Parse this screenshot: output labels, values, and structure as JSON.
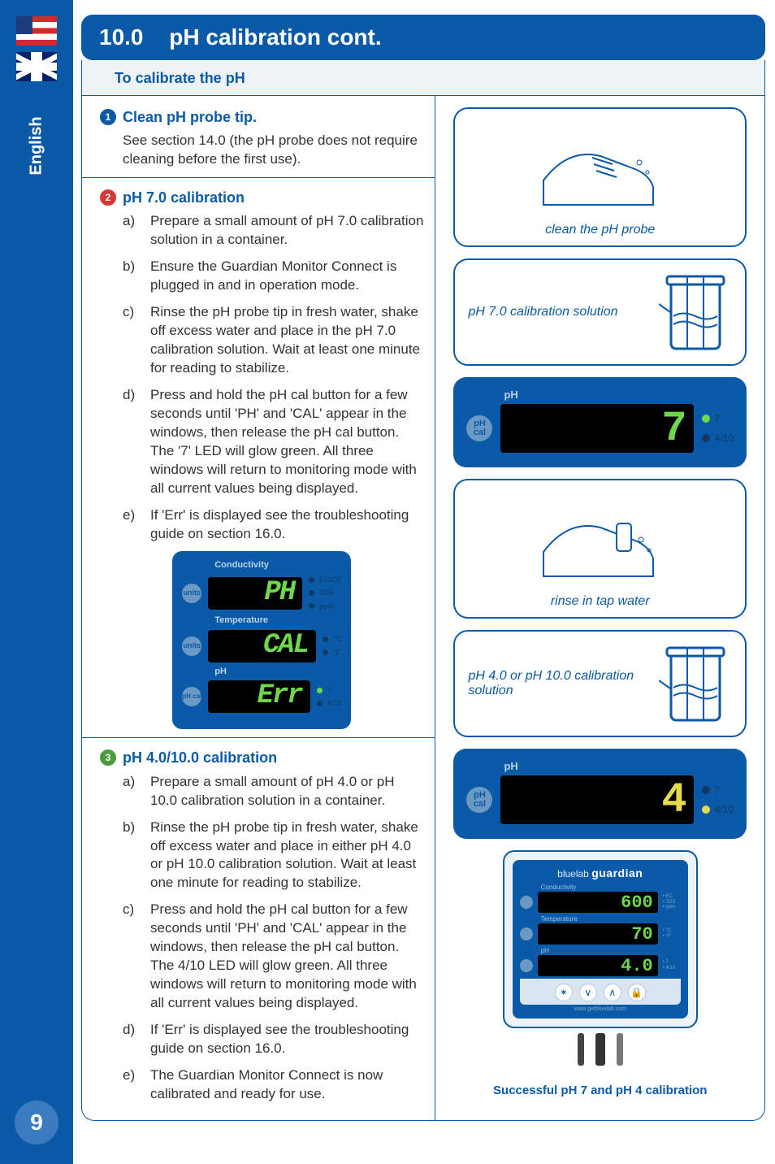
{
  "sidebar": {
    "language": "English",
    "page_number": "9"
  },
  "header": {
    "section_number": "10.0",
    "section_title": "pH calibration cont."
  },
  "subheader": "To calibrate the pH",
  "steps": {
    "s1": {
      "num": "1",
      "title": "Clean pH probe tip.",
      "body": "See section 14.0 (the pH probe does not require cleaning before the first use)."
    },
    "s2": {
      "num": "2",
      "title": "pH 7.0 calibration",
      "items": {
        "a": {
          "lbl": "a)",
          "txt": "Prepare a small amount of pH 7.0 calibration solution in a container."
        },
        "b": {
          "lbl": "b)",
          "txt": "Ensure the Guardian Monitor Connect is plugged in and in operation mode."
        },
        "c": {
          "lbl": "c)",
          "txt": "Rinse the pH probe tip in fresh water, shake off excess water and place in the pH 7.0 calibration solution. Wait at least one minute for reading to stabilize."
        },
        "d": {
          "lbl": "d)",
          "txt": "Press and hold the pH cal button for a few seconds until 'PH' and 'CAL' appear in the windows, then release the pH cal button. The '7' LED will glow green. All three windows will return to monitoring mode with all current values being displayed."
        },
        "e": {
          "lbl": "e)",
          "txt": "If 'Err' is displayed see the troubleshooting guide on section 16.0."
        }
      }
    },
    "s3": {
      "num": "3",
      "title": "pH 4.0/10.0 calibration",
      "items": {
        "a": {
          "lbl": "a)",
          "txt": "Prepare a small amount of pH 4.0 or pH 10.0 calibration solution in a container."
        },
        "b": {
          "lbl": "b)",
          "txt": "Rinse the pH probe tip in fresh water, shake off excess water and place in either pH 4.0 or pH 10.0 calibration solution. Wait at least one minute for reading to stabilize."
        },
        "c": {
          "lbl": "c)",
          "txt": "Press and hold the pH cal button for a few seconds until 'PH' and 'CAL' appear in the windows, then release the pH cal button. The 4/10 LED will glow green. All three windows will return to monitoring mode with all current values being displayed."
        },
        "d": {
          "lbl": "d)",
          "txt": "If 'Err' is displayed see the troubleshooting guide on section 16.0."
        },
        "e": {
          "lbl": "e)",
          "txt": "The Guardian Monitor Connect is now calibrated and ready for use."
        }
      }
    }
  },
  "tripanel": {
    "r1": {
      "title": "Conductivity",
      "btn": "units",
      "lcd": "PH",
      "leds": [
        "EC/CF",
        "TDS",
        "ppm"
      ]
    },
    "r2": {
      "title": "Temperature",
      "btn": "units",
      "lcd": "CAL",
      "leds": [
        "°C",
        "°F"
      ]
    },
    "r3": {
      "title": "pH",
      "btn": "pH cal",
      "lcd": "Err",
      "led7": "7",
      "led410": "4/10"
    }
  },
  "right": {
    "c1": "clean the pH probe",
    "c2": "pH 7.0 calibration solution",
    "panel7": {
      "title": "pH",
      "btn": "pH cal",
      "lcd": "7",
      "led7": "7",
      "led410": "4/10"
    },
    "c3": "rinse in tap water",
    "c4": "pH 4.0 or pH 10.0 calibration solution",
    "panel4": {
      "title": "pH",
      "btn": "pH cal",
      "lcd": "4",
      "led7": "7",
      "led410": "4/10"
    },
    "product": {
      "brand_small": "bluelab",
      "brand": "guardian",
      "r1": {
        "title": "Conductivity",
        "lcd": "600"
      },
      "r2": {
        "title": "Temperature",
        "lcd": "70"
      },
      "r3": {
        "title": "pH",
        "lcd": "4.0"
      },
      "site": "www.getbluelab.com"
    },
    "footer": "Successful pH 7 and pH 4 calibration"
  }
}
